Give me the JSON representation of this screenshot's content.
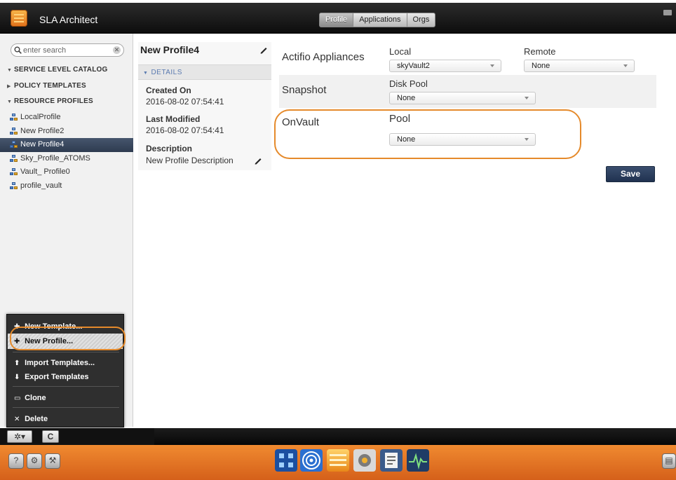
{
  "app": {
    "title": "SLA Architect"
  },
  "tabs": [
    "Profile",
    "Applications",
    "Orgs"
  ],
  "sidebar": {
    "search_placeholder": "enter search",
    "catalog_header": "SERVICE LEVEL CATALOG",
    "policy_templates": "POLICY TEMPLATES",
    "resource_profiles": "RESOURCE PROFILES",
    "profiles": [
      "LocalProfile",
      "New Profile2",
      "New Profile4",
      "Sky_Profile_ATOMS",
      "Vault_ Profile0",
      "profile_vault"
    ]
  },
  "menu": {
    "new_template": "New Template...",
    "new_profile": "New Profile...",
    "import_templates": "Import Templates...",
    "export_templates": "Export Templates",
    "clone": "Clone",
    "delete": "Delete"
  },
  "toolbar": {
    "gear_glyph": "✲▾",
    "refresh_glyph": "C"
  },
  "detail": {
    "title": "New Profile4",
    "section": "DETAILS",
    "created_label": "Created On",
    "created_value": "2016-08-02 07:54:41",
    "modified_label": "Last Modified",
    "modified_value": "2016-08-02 07:54:41",
    "description_label": "Description",
    "description_value": "New Profile Description"
  },
  "form": {
    "appliances_label": "Actifio Appliances",
    "local_label": "Local",
    "local_value": "skyVault2",
    "remote_label": "Remote",
    "remote_value": "None",
    "snapshot_label": "Snapshot",
    "disk_pool_label": "Disk Pool",
    "disk_pool_value": "None",
    "onvault_label": "OnVault",
    "pool_label": "Pool",
    "pool_value": "None",
    "save_label": "Save"
  },
  "colors": {
    "highlight": "#e58a2b",
    "dock": "#e8742a",
    "selected": "#34435a"
  }
}
